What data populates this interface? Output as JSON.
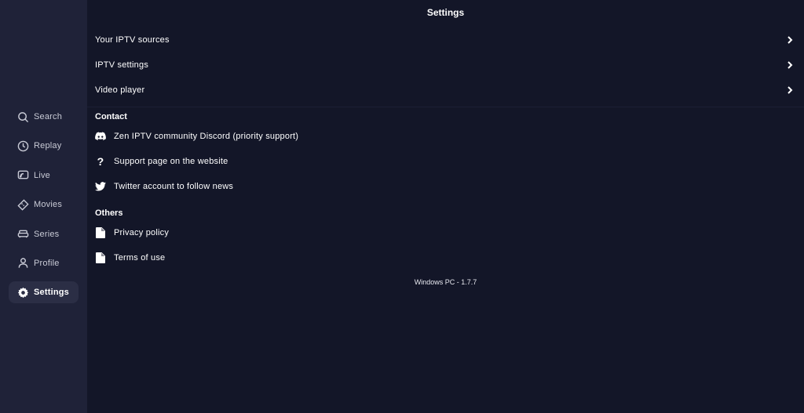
{
  "sidebar": {
    "items": [
      {
        "label": "Search",
        "icon": "search-icon"
      },
      {
        "label": "Replay",
        "icon": "clock-icon"
      },
      {
        "label": "Live",
        "icon": "tv-icon"
      },
      {
        "label": "Movies",
        "icon": "ticket-icon"
      },
      {
        "label": "Series",
        "icon": "couch-icon"
      },
      {
        "label": "Profile",
        "icon": "user-icon"
      },
      {
        "label": "Settings",
        "icon": "gear-icon",
        "active": true
      }
    ]
  },
  "header": {
    "title": "Settings"
  },
  "settings": {
    "rows": [
      {
        "label": "Your IPTV sources"
      },
      {
        "label": "IPTV settings"
      },
      {
        "label": "Video player"
      }
    ]
  },
  "contact": {
    "title": "Contact",
    "items": [
      {
        "label": "Zen IPTV community Discord (priority support)",
        "icon": "discord-icon"
      },
      {
        "label": "Support page on the website",
        "icon": "question-icon"
      },
      {
        "label": "Twitter account to follow news",
        "icon": "twitter-icon"
      }
    ]
  },
  "others": {
    "title": "Others",
    "items": [
      {
        "label": "Privacy policy",
        "icon": "document-icon"
      },
      {
        "label": "Terms of use",
        "icon": "document-icon"
      }
    ]
  },
  "footer": {
    "version": "Windows PC - 1.7.7"
  },
  "colors": {
    "background": "#131628",
    "sidebar": "#1f2238",
    "active_item": "#2b2e45"
  }
}
